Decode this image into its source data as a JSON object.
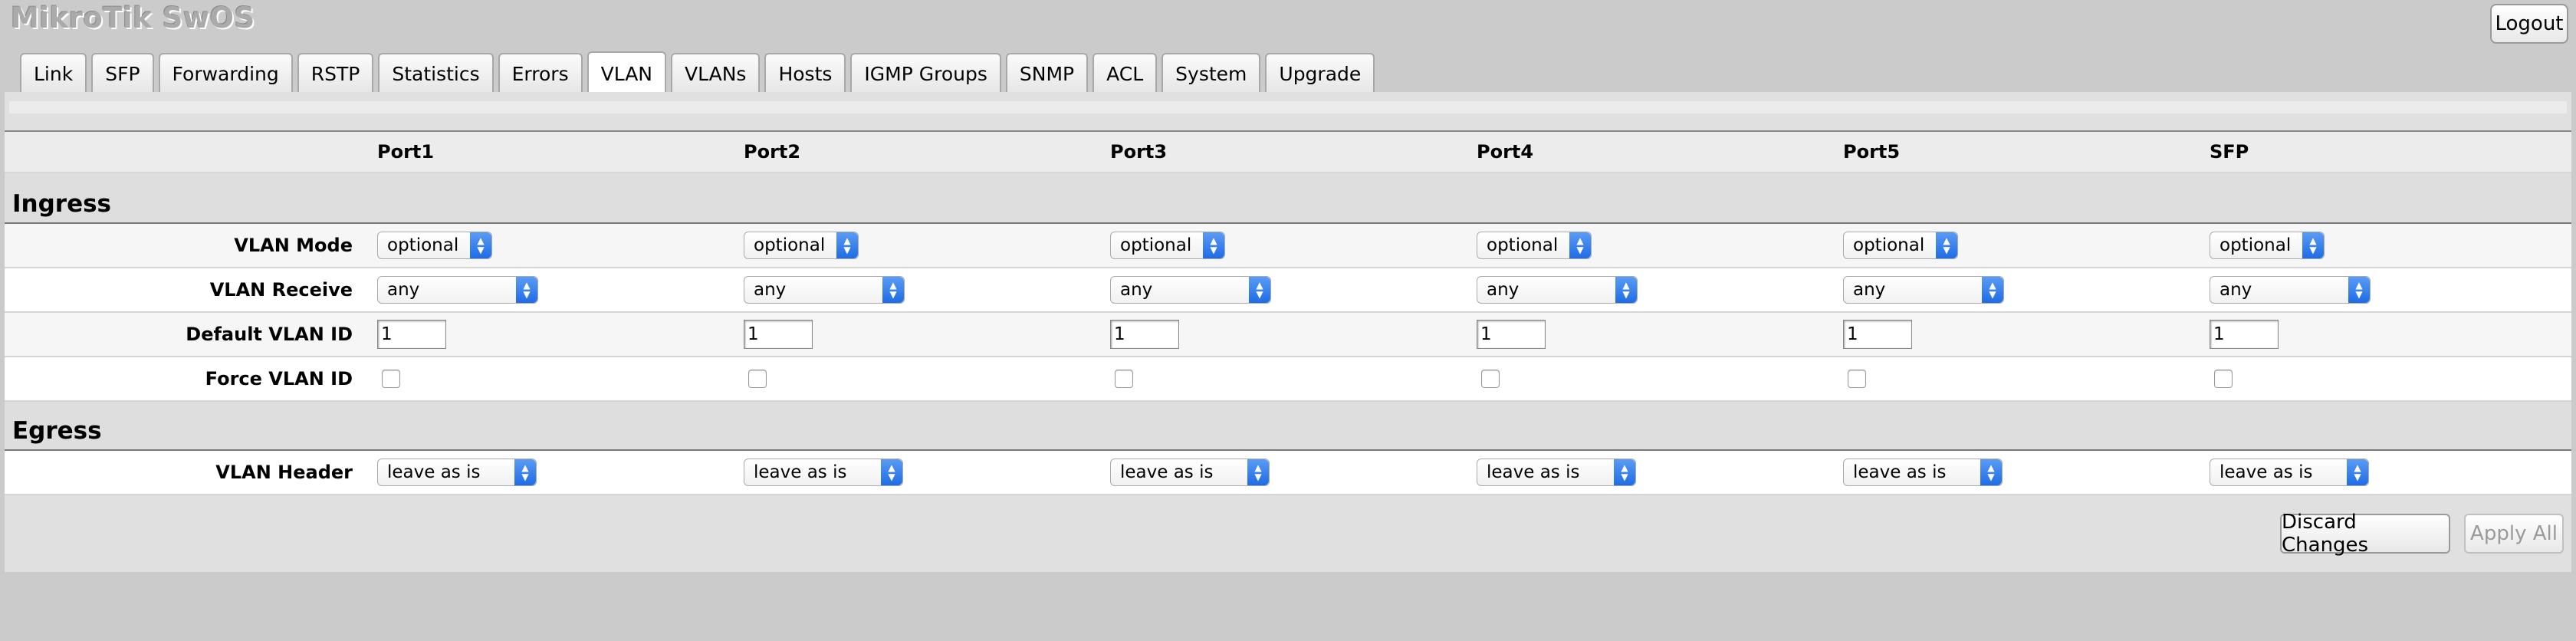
{
  "app": {
    "title": "MikroTik SwOS",
    "logout_label": "Logout"
  },
  "tabs": [
    "Link",
    "SFP",
    "Forwarding",
    "RSTP",
    "Statistics",
    "Errors",
    "VLAN",
    "VLANs",
    "Hosts",
    "IGMP Groups",
    "SNMP",
    "ACL",
    "System",
    "Upgrade"
  ],
  "active_tab": "VLAN",
  "ports": [
    "Port1",
    "Port2",
    "Port3",
    "Port4",
    "Port5",
    "SFP"
  ],
  "sections": {
    "ingress": "Ingress",
    "egress": "Egress"
  },
  "rows": {
    "vlan_mode": {
      "label": "VLAN Mode",
      "values": [
        "optional",
        "optional",
        "optional",
        "optional",
        "optional",
        "optional"
      ]
    },
    "vlan_receive": {
      "label": "VLAN Receive",
      "values": [
        "any",
        "any",
        "any",
        "any",
        "any",
        "any"
      ]
    },
    "default_vlan_id": {
      "label": "Default VLAN ID",
      "values": [
        "1",
        "1",
        "1",
        "1",
        "1",
        "1"
      ]
    },
    "force_vlan_id": {
      "label": "Force VLAN ID",
      "checked": [
        false,
        false,
        false,
        false,
        false,
        false
      ]
    },
    "vlan_header": {
      "label": "VLAN Header",
      "values": [
        "leave as is",
        "leave as is",
        "leave as is",
        "leave as is",
        "leave as is",
        "leave as is"
      ]
    }
  },
  "buttons": {
    "discard": "Discard Changes",
    "apply": "Apply All"
  }
}
